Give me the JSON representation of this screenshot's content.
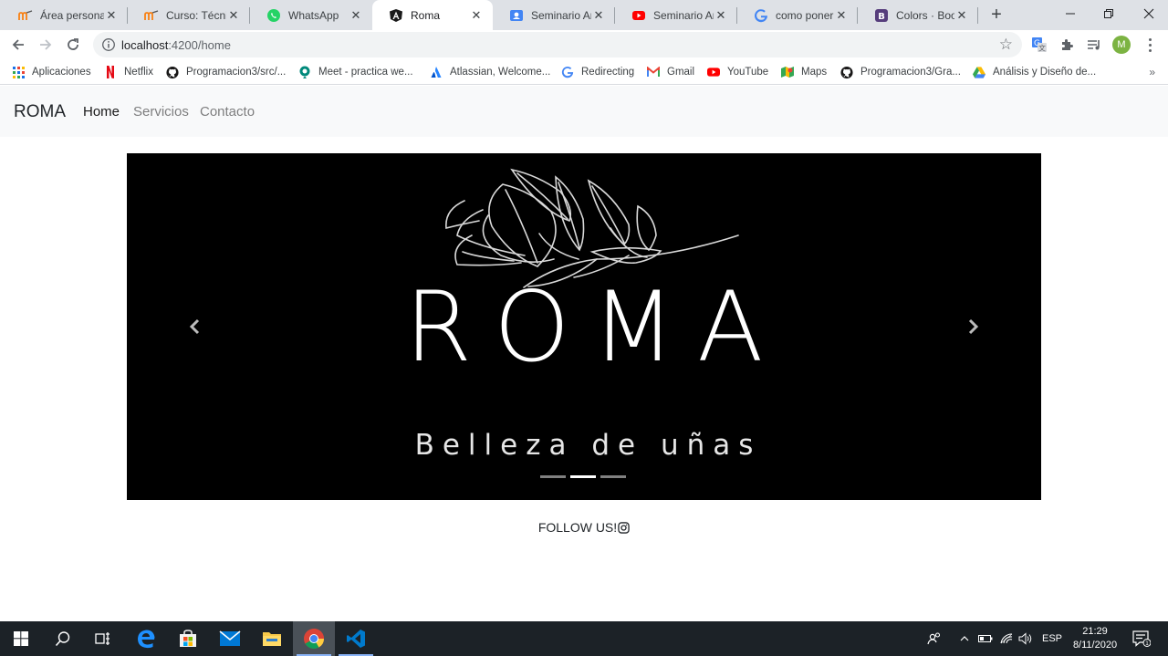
{
  "browser": {
    "tabs": [
      {
        "title": "Área personal",
        "icon": "moodle-icon"
      },
      {
        "title": "Curso: Técnica",
        "icon": "moodle-icon"
      },
      {
        "title": "WhatsApp",
        "icon": "whatsapp-icon"
      },
      {
        "title": "Roma",
        "icon": "angular-icon",
        "active": true
      },
      {
        "title": "Seminario Ang",
        "icon": "contact-icon"
      },
      {
        "title": "Seminario Ang",
        "icon": "youtube-icon"
      },
      {
        "title": "como poner al",
        "icon": "google-icon"
      },
      {
        "title": "Colors · Boots",
        "icon": "bootstrap-icon"
      }
    ],
    "address": {
      "host": "localhost",
      "path": ":4200/home"
    },
    "profile_initial": "M",
    "bookmarks": [
      {
        "label": "Aplicaciones",
        "icon": "apps-grid-icon"
      },
      {
        "label": "Netflix",
        "icon": "netflix-icon"
      },
      {
        "label": "Programacion3/src/...",
        "icon": "github-icon"
      },
      {
        "label": "Meet - practica we...",
        "icon": "meet-icon"
      },
      {
        "label": "Atlassian, Welcome...",
        "icon": "atlassian-icon"
      },
      {
        "label": "Redirecting",
        "icon": "google-icon"
      },
      {
        "label": "Gmail",
        "icon": "gmail-icon"
      },
      {
        "label": "YouTube",
        "icon": "youtube-icon"
      },
      {
        "label": "Maps",
        "icon": "maps-icon"
      },
      {
        "label": "Programacion3/Gra...",
        "icon": "github-icon"
      },
      {
        "label": "Análisis y Diseño de...",
        "icon": "drive-icon"
      }
    ],
    "bookmarks_overflow": "»"
  },
  "site": {
    "brand": "ROMA",
    "nav": [
      {
        "label": "Home",
        "active": true
      },
      {
        "label": "Servicios",
        "active": false
      },
      {
        "label": "Contacto",
        "active": false
      }
    ],
    "carousel": {
      "title": "ROMA",
      "subtitle": "Belleza de uñas",
      "slide_count": 3,
      "active_slide": 2
    },
    "follow_text": "FOLLOW US!"
  },
  "taskbar": {
    "language": "ESP",
    "time": "21:29",
    "date": "8/11/2020",
    "notification_count": "1"
  }
}
